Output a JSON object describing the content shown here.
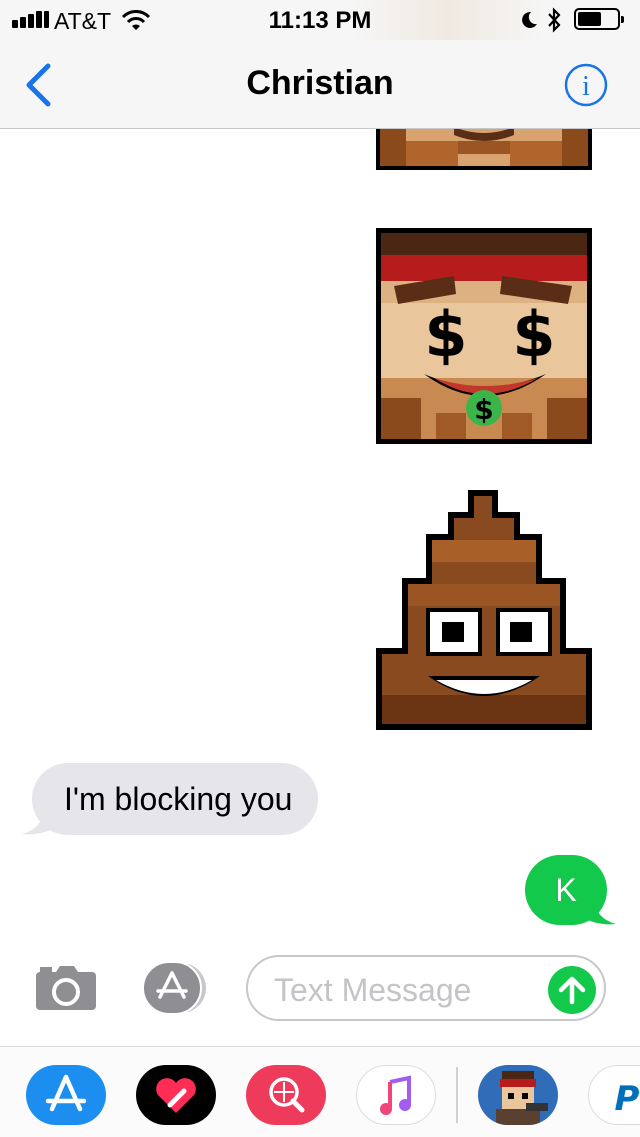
{
  "status_bar": {
    "carrier": "AT&T",
    "time": "11:13 PM",
    "icons": [
      "signal-bars-icon",
      "wifi-icon",
      "moon-icon",
      "bluetooth-icon",
      "battery-icon"
    ]
  },
  "nav": {
    "back_icon": "chevron-left-icon",
    "title": "Christian",
    "info_icon": "info-icon",
    "accent_color": "#1a73e8"
  },
  "messages": [
    {
      "type": "sticker",
      "sender": "me",
      "sticker": "pixel-face-sticker"
    },
    {
      "type": "sticker",
      "sender": "me",
      "sticker": "pixel-money-face-sticker"
    },
    {
      "type": "sticker",
      "sender": "me",
      "sticker": "pixel-poop-sticker"
    },
    {
      "type": "text",
      "sender": "them",
      "text": "I'm blocking you"
    },
    {
      "type": "text",
      "sender": "me",
      "text": "K"
    }
  ],
  "composer": {
    "camera_icon": "camera-icon",
    "apps_icon": "app-store-icon",
    "placeholder": "Text Message",
    "value": "",
    "send_icon": "send-arrow-icon",
    "send_color": "#12c94c"
  },
  "app_drawer": {
    "apps": [
      "app-store-icon",
      "digital-touch-heart-icon",
      "images-search-icon",
      "music-icon",
      "game-sticker-icon",
      "paypal-icon"
    ]
  },
  "colors": {
    "received_bubble": "#e5e5ea",
    "sent_bubble": "#12c94c"
  }
}
